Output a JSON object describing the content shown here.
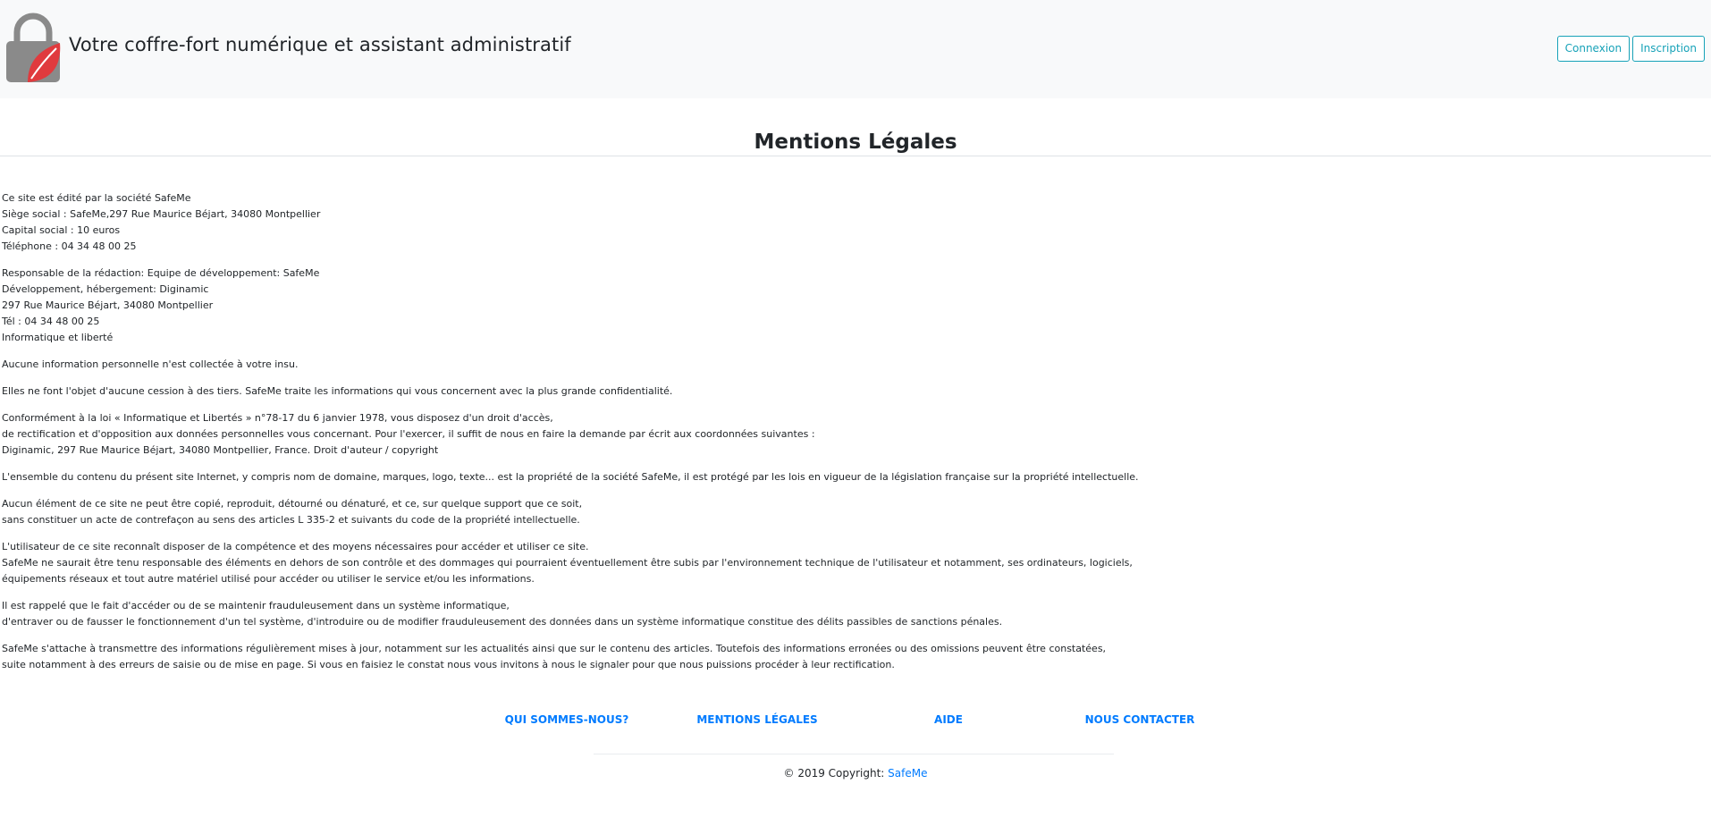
{
  "header": {
    "title": "Votre coffre-fort numérique et assistant administratif",
    "login_label": "Connexion",
    "signup_label": "Inscription",
    "logo_icon": "padlock-leaf-icon",
    "colors": {
      "lock_gray": "#8a8a8a",
      "leaf_red": "#e03a3e",
      "accent": "#17a2b8"
    }
  },
  "page_title": "Mentions Légales",
  "content": {
    "paragraphs": [
      [
        "Ce site est édité par la société SafeMe",
        "Siège social : SafeMe,297 Rue Maurice Béjart, 34080 Montpellier",
        "Capital social : 10 euros",
        "Téléphone : 04 34 48 00 25"
      ],
      [
        "Responsable de la rédaction: Equipe de développement: SafeMe",
        "Développement, hébergement: Diginamic",
        "297 Rue Maurice Béjart, 34080 Montpellier",
        "Tél : 04 34 48 00 25",
        "Informatique et liberté"
      ],
      [
        "Aucune information personnelle n'est collectée à votre insu."
      ],
      [
        "Elles ne font l'objet d'aucune cession à des tiers. SafeMe traite les informations qui vous concernent avec la plus grande confidentialité."
      ],
      [
        "Conformément à la loi « Informatique et Libertés » n°78-17 du 6 janvier 1978, vous disposez d'un droit d'accès,",
        "de rectification et d'opposition aux données personnelles vous concernant. Pour l'exercer, il suffit de nous en faire la demande par écrit aux coordonnées suivantes :",
        "Diginamic, 297 Rue Maurice Béjart, 34080 Montpellier, France. Droit d'auteur / copyright"
      ],
      [
        "L'ensemble du contenu du présent site Internet, y compris nom de domaine, marques, logo, texte... est la propriété de la société SafeMe, il est protégé par les lois en vigueur de la législation française sur la propriété intellectuelle."
      ],
      [
        "Aucun élément de ce site ne peut être copié, reproduit, détourné ou dénaturé, et ce, sur quelque support que ce soit,",
        "sans constituer un acte de contrefaçon au sens des articles L 335-2 et suivants du code de la propriété intellectuelle."
      ],
      [
        "L'utilisateur de ce site reconnaît disposer de la compétence et des moyens nécessaires pour accéder et utiliser ce site.",
        "SafeMe ne saurait être tenu responsable des éléments en dehors de son contrôle et des dommages qui pourraient éventuellement être subis par l'environnement technique de l'utilisateur et notamment, ses ordinateurs, logiciels,",
        "équipements réseaux et tout autre matériel utilisé pour accéder ou utiliser le service et/ou les informations."
      ],
      [
        "Il est rappelé que le fait d'accéder ou de se maintenir frauduleusement dans un système informatique,",
        "d'entraver ou de fausser le fonctionnement d'un tel système, d'introduire ou de modifier frauduleusement des données dans un système informatique constitue des délits passibles de sanctions pénales."
      ],
      [
        "SafeMe s'attache à transmettre des informations régulièrement mises à jour, notamment sur les actualités ainsi que sur le contenu des articles. Toutefois des informations erronées ou des omissions peuvent être constatées,",
        "suite notamment à des erreurs de saisie ou de mise en page. Si vous en faisiez le constat nous vous invitons à nous le signaler pour que nous puissions procéder à leur rectification."
      ]
    ]
  },
  "footer": {
    "links": [
      {
        "label": "QUI SOMMES-NOUS?"
      },
      {
        "label": "MENTIONS LÉGALES"
      },
      {
        "label": "AIDE"
      },
      {
        "label": "NOUS CONTACTER"
      }
    ],
    "copyright_prefix": "© 2019 Copyright: ",
    "copyright_link": "SafeMe",
    "link_color": "#007bff"
  }
}
